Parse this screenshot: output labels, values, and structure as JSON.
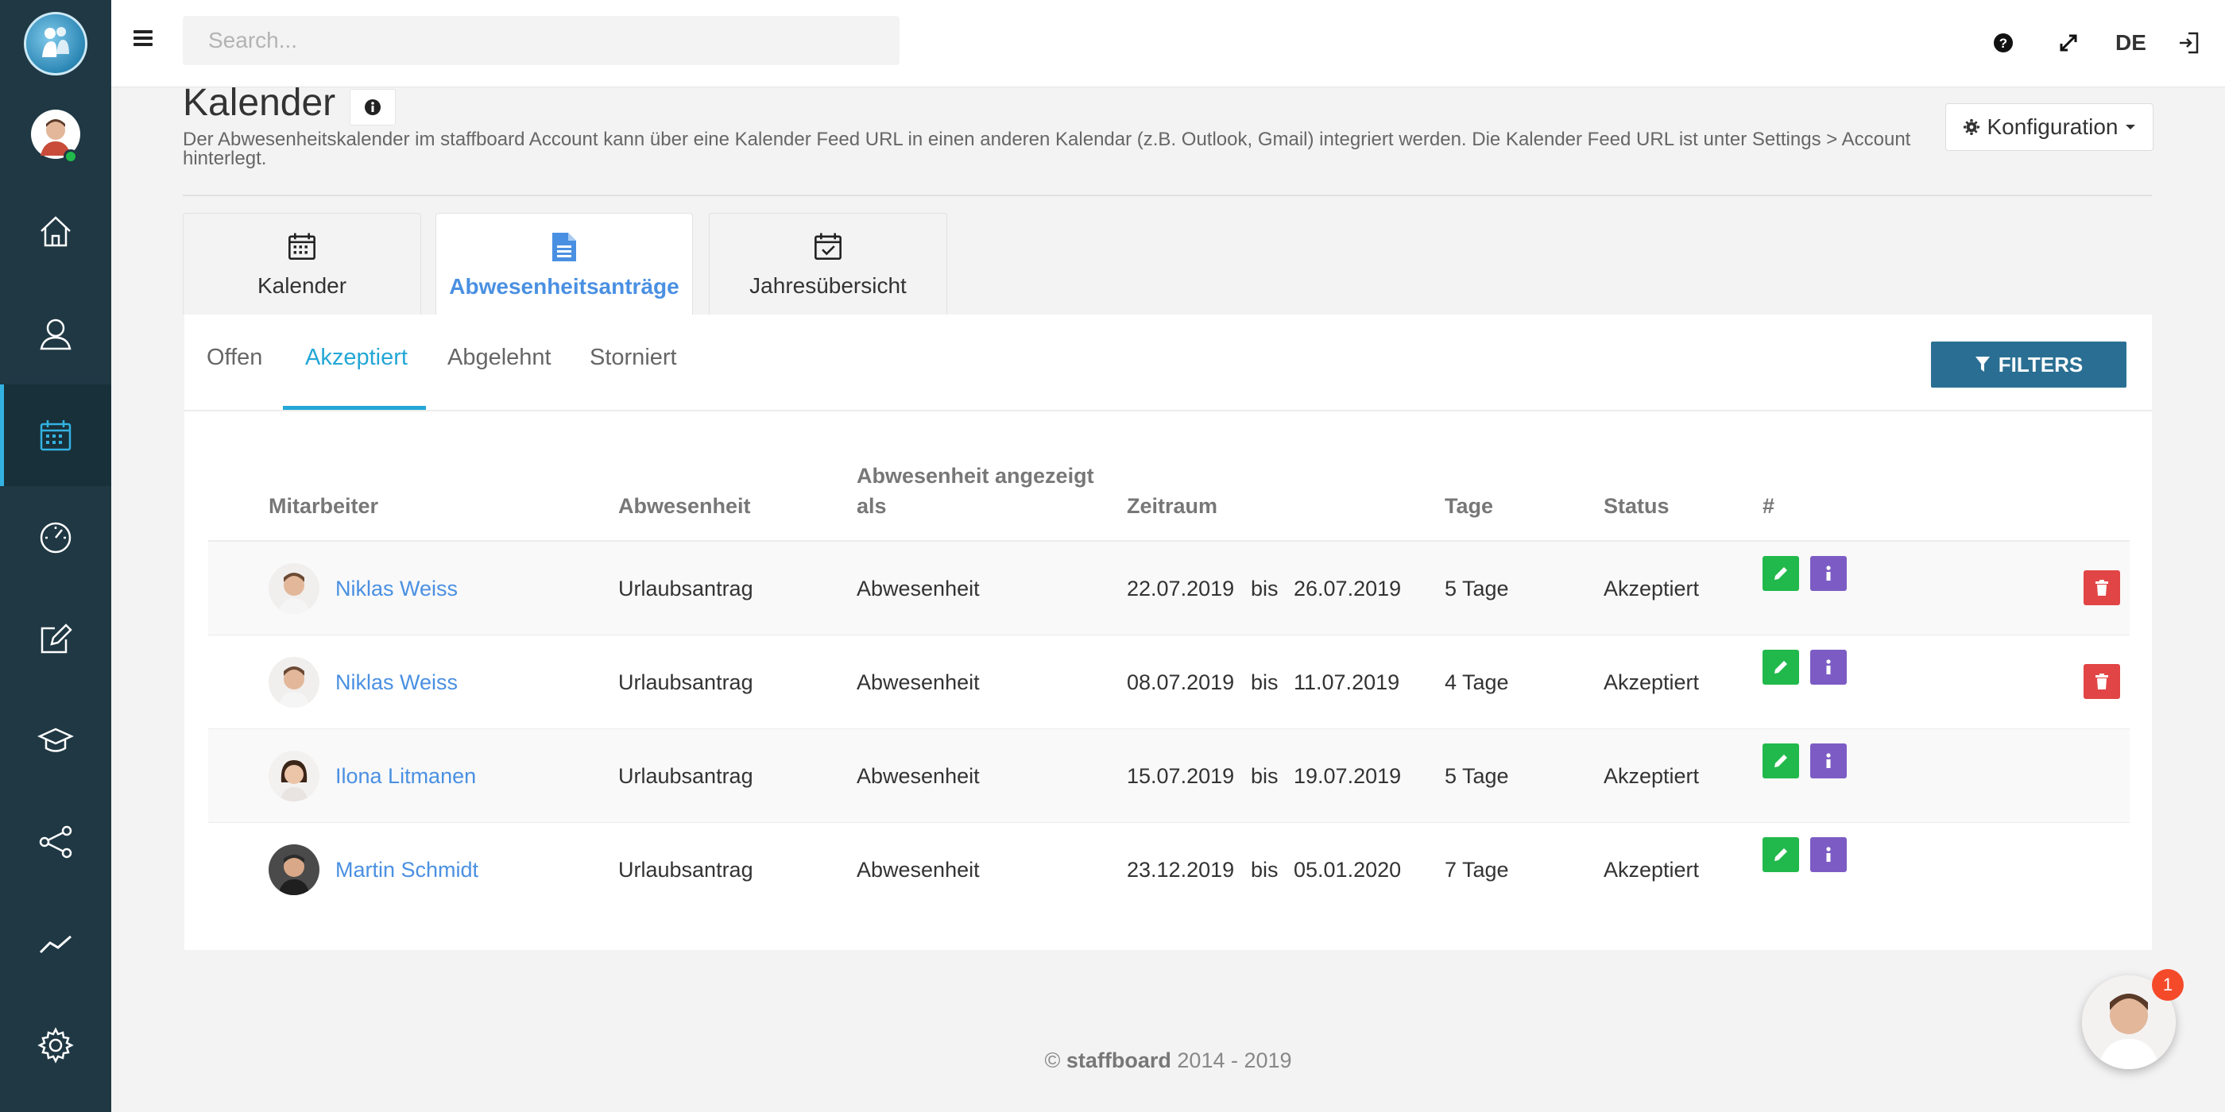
{
  "header": {
    "search_placeholder": "Search...",
    "language": "DE"
  },
  "page": {
    "title": "Kalender",
    "description": "Der Abwesenheitskalender im staffboard Account kann über eine Kalender Feed URL in einen anderen Kalendar (z.B. Outlook, Gmail) integriert werden. Die Kalender Feed URL ist unter Settings > Account hinterlegt.",
    "config_label": "Konfiguration"
  },
  "top_tabs": [
    {
      "label": "Kalender",
      "icon": "calendar-icon"
    },
    {
      "label": "Abwesenheitsanträge",
      "icon": "document-icon"
    },
    {
      "label": "Jahresübersicht",
      "icon": "calendar-check-icon"
    }
  ],
  "sub_tabs": [
    "Offen",
    "Akzeptiert",
    "Abgelehnt",
    "Storniert"
  ],
  "filters_label": "FILTERS",
  "table": {
    "headers": [
      "Mitarbeiter",
      "Abwesenheit",
      "Abwesenheit angezeigt als",
      "Zeitraum",
      "Tage",
      "Status",
      "#"
    ],
    "rows": [
      {
        "name": "Niklas Weiss",
        "type": "Urlaubsantrag",
        "shown_as": "Abwesenheit",
        "from": "22.07.2019",
        "sep": "bis",
        "to": "26.07.2019",
        "days": "5 Tage",
        "status": "Akzeptiert"
      },
      {
        "name": "Niklas Weiss",
        "type": "Urlaubsantrag",
        "shown_as": "Abwesenheit",
        "from": "08.07.2019",
        "sep": "bis",
        "to": "11.07.2019",
        "days": "4 Tage",
        "status": "Akzeptiert"
      },
      {
        "name": "Ilona Litmanen",
        "type": "Urlaubsantrag",
        "shown_as": "Abwesenheit",
        "from": "15.07.2019",
        "sep": "bis",
        "to": "19.07.2019",
        "days": "5 Tage",
        "status": "Akzeptiert"
      },
      {
        "name": "Martin Schmidt",
        "type": "Urlaubsantrag",
        "shown_as": "Abwesenheit",
        "from": "23.12.2019",
        "sep": "bis",
        "to": "05.01.2020",
        "days": "7 Tage",
        "status": "Akzeptiert"
      }
    ]
  },
  "footer": {
    "copyright": "©",
    "brand": "staffboard",
    "years": "2014 - 2019"
  },
  "chat": {
    "badge": "1"
  },
  "colors": {
    "sidebar": "#1f3844",
    "accent": "#23a7d6",
    "link": "#4a90e2",
    "filters": "#2a6f93",
    "edit": "#21b94b",
    "info": "#7c5cc4",
    "delete": "#e24545"
  }
}
